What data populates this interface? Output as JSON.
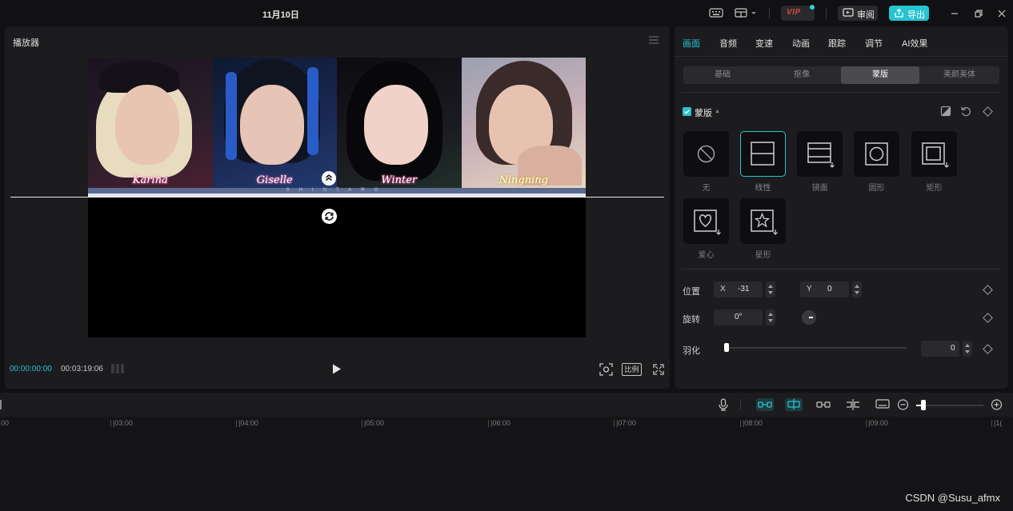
{
  "titlebar": {
    "title": "11月10日",
    "vip_label": "VIP",
    "review_label": "审阅",
    "export_label": "导出"
  },
  "player": {
    "title": "播放器",
    "current_time": "00:00:00:00",
    "total_time": "00:03:19:06",
    "ratio_label": "比例",
    "photos": [
      {
        "name": "Karina"
      },
      {
        "name": "Giselle"
      },
      {
        "name": "Winter"
      },
      {
        "name": "Ningning"
      }
    ],
    "strip_text": "SHINTARO"
  },
  "panel": {
    "tabs": [
      "画面",
      "音频",
      "变速",
      "动画",
      "跟踪",
      "调节",
      "AI效果"
    ],
    "active_tab": "画面",
    "subtabs": [
      "基础",
      "抠像",
      "蒙版",
      "美颜美体"
    ],
    "active_subtab": "蒙版",
    "mask_section": "蒙版",
    "mask_options": [
      {
        "label": "无",
        "icon": "none-icon"
      },
      {
        "label": "线性",
        "icon": "linear-mask-icon"
      },
      {
        "label": "镜面",
        "icon": "mirror-mask-icon"
      },
      {
        "label": "圆形",
        "icon": "circle-mask-icon"
      },
      {
        "label": "矩形",
        "icon": "rectangle-mask-icon"
      },
      {
        "label": "爱心",
        "icon": "heart-mask-icon"
      },
      {
        "label": "星形",
        "icon": "star-mask-icon"
      }
    ],
    "selected_mask": "线性",
    "position_label": "位置",
    "pos_x_axis": "X",
    "pos_x": "-31",
    "pos_y_axis": "Y",
    "pos_y": "0",
    "rotate_label": "旋转",
    "rotate_value": "0°",
    "feather_label": "羽化",
    "feather_value": "0",
    "accent": "#29c1cf"
  },
  "timeline": {
    "ticks": [
      "00",
      "|03:00",
      "|04:00",
      "|05:00",
      "|06:00",
      "|07:00",
      "|08:00",
      "|09:00",
      "|1("
    ]
  },
  "watermark": "CSDN @Susu_afmx"
}
